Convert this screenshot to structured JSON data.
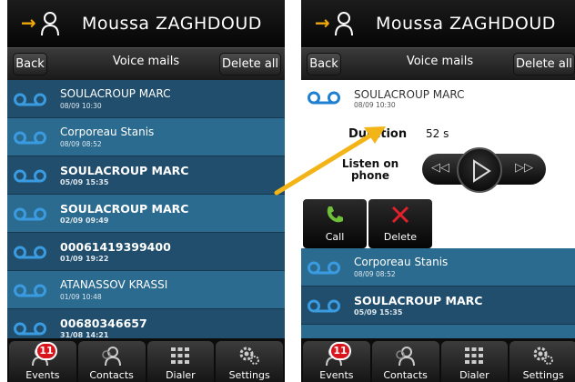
{
  "left": {
    "header": {
      "title": "Moussa ZAGHDOUD"
    },
    "toolbar": {
      "back_label": "Back",
      "title": "Voice mails",
      "delete_all_label": "Delete all"
    },
    "voicemails": [
      {
        "name": "SOULACROUP MARC",
        "date": "08/09 10:30"
      },
      {
        "name": "Corporeau Stanis",
        "date": "08/09 08:52"
      },
      {
        "name": "SOULACROUP MARC",
        "date": "05/09 15:35"
      },
      {
        "name": "SOULACROUP MARC",
        "date": "02/09 09:49"
      },
      {
        "name": "00061419399400",
        "date": "01/09 19:22"
      },
      {
        "name": "ATANASSOV KRASSI",
        "date": "01/09 10:48"
      },
      {
        "name": "00680346657",
        "date": "31/08 14:21"
      }
    ],
    "tabs": [
      {
        "label": "Events",
        "badge": "11"
      },
      {
        "label": "Contacts"
      },
      {
        "label": "Dialer"
      },
      {
        "label": "Settings"
      }
    ]
  },
  "right": {
    "header": {
      "title": "Moussa ZAGHDOUD"
    },
    "toolbar": {
      "back_label": "Back",
      "title": "Voice mails",
      "delete_all_label": "Delete all"
    },
    "detail": {
      "name": "SOULACROUP MARC",
      "date": "08/09 10:30",
      "duration_label": "Duration",
      "duration_value": "52 s",
      "listen_label": "Listen on phone"
    },
    "actions": {
      "call_label": "Call",
      "delete_label": "Delete"
    },
    "voicemails": [
      {
        "name": "Corporeau Stanis",
        "date": "08/09 08:52"
      },
      {
        "name": "SOULACROUP MARC",
        "date": "05/09 15:35"
      }
    ],
    "tabs": [
      {
        "label": "Events",
        "badge": "11"
      },
      {
        "label": "Contacts"
      },
      {
        "label": "Dialer"
      },
      {
        "label": "Settings"
      }
    ]
  },
  "colors": {
    "accent_arrow": "#f2b416",
    "list_row": "#204e6c",
    "list_row_alt": "#2b6b8f",
    "voicemail_icon": "#3a9be0",
    "badge": "#d8141c",
    "call_icon": "#6fbf3a",
    "delete_icon": "#e0202a"
  },
  "icons": [
    "arrow-right-icon",
    "person-icon",
    "voicemail-icon",
    "events-icon",
    "contacts-icon",
    "dialer-icon",
    "settings-icon",
    "rewind-icon",
    "play-icon",
    "fast-forward-icon",
    "phone-icon",
    "delete-x-icon"
  ]
}
